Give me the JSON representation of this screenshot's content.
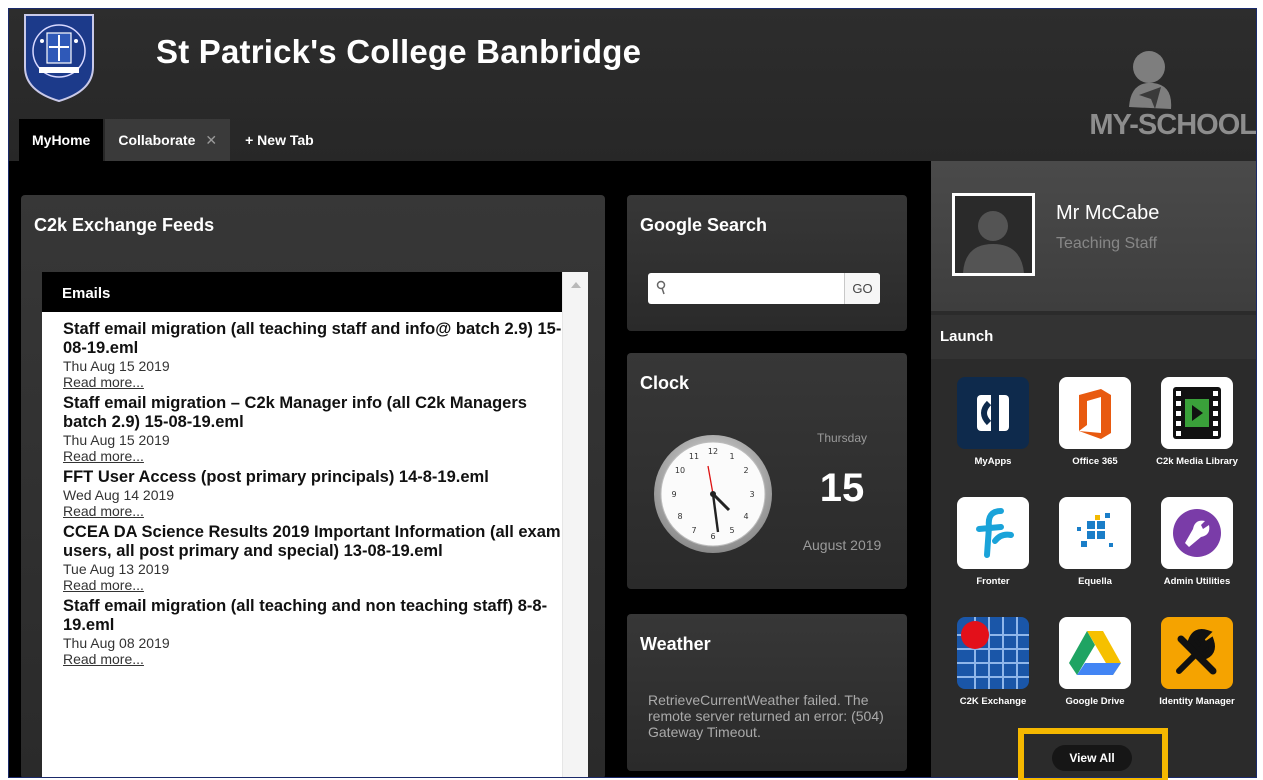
{
  "header": {
    "school_name": "St Patrick's College Banbridge",
    "brand": "MY-SCHOOL"
  },
  "tabs": [
    {
      "label": "MyHome",
      "active": true
    },
    {
      "label": "Collaborate",
      "active": false,
      "closable": true
    },
    {
      "label": "+ New Tab",
      "active": false
    }
  ],
  "feeds": {
    "title": "C2k Exchange Feeds",
    "emails_header": "Emails",
    "items": [
      {
        "subject": "Staff email migration (all teaching staff and info@ batch 2.9) 15-08-19.eml",
        "date": "Thu Aug 15 2019",
        "link": "Read more..."
      },
      {
        "subject": "Staff email migration – C2k Manager info (all C2k Managers batch 2.9) 15-08-19.eml",
        "date": "Thu Aug 15 2019",
        "link": "Read more..."
      },
      {
        "subject": "FFT User Access (post primary principals) 14-8-19.eml",
        "date": "Wed Aug 14 2019",
        "link": "Read more..."
      },
      {
        "subject": "CCEA DA Science Results 2019 Important Information (all exam users, all post primary and special) 13-08-19.eml",
        "date": "Tue Aug 13 2019",
        "link": "Read more..."
      },
      {
        "subject": "Staff email migration (all teaching and non teaching staff) 8-8-19.eml",
        "date": "Thu Aug 08 2019",
        "link": "Read more..."
      }
    ]
  },
  "search": {
    "title": "Google Search",
    "input_value": "",
    "go_label": "GO"
  },
  "clock": {
    "title": "Clock",
    "day": "Thursday",
    "date": "15",
    "month_year": "August 2019"
  },
  "weather": {
    "title": "Weather",
    "message": "RetrieveCurrentWeather failed. The remote server returned an error: (504) Gateway Timeout."
  },
  "user": {
    "name": "Mr McCabe",
    "role": "Teaching Staff"
  },
  "launch": {
    "title": "Launch",
    "apps": [
      {
        "label": "MyApps",
        "icon": "myapps-icon",
        "color": "#0e2a4c"
      },
      {
        "label": "Office 365",
        "icon": "office365-icon",
        "color": "#ffffff"
      },
      {
        "label": "C2k Media Library",
        "icon": "media-library-icon",
        "color": "#ffffff"
      },
      {
        "label": "Fronter",
        "icon": "fronter-icon",
        "color": "#ffffff"
      },
      {
        "label": "Equella",
        "icon": "equella-icon",
        "color": "#ffffff"
      },
      {
        "label": "Admin Utilities",
        "icon": "admin-utilities-icon",
        "color": "#ffffff"
      },
      {
        "label": "C2K Exchange",
        "icon": "c2k-exchange-icon",
        "color": "#1a56a8"
      },
      {
        "label": "Google Drive",
        "icon": "google-drive-icon",
        "color": "#ffffff"
      },
      {
        "label": "Identity Manager",
        "icon": "identity-manager-icon",
        "color": "#f5a300"
      }
    ],
    "view_all": "View All"
  }
}
